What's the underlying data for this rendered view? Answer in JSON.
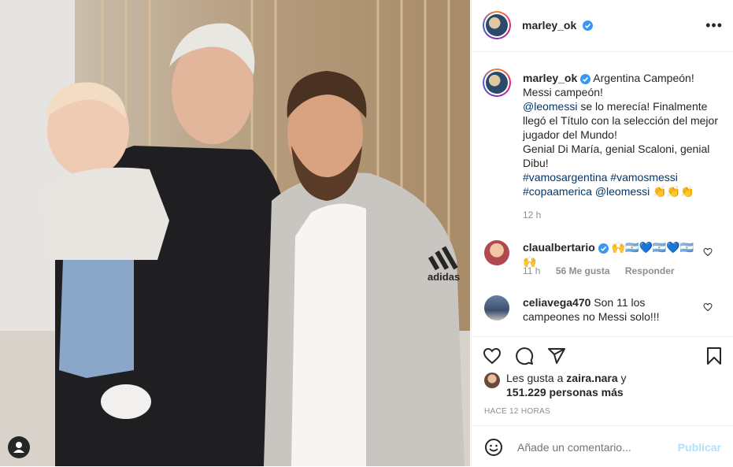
{
  "post": {
    "image_alt": "Photo of two men and a baby",
    "author": "marley_ok"
  },
  "header": {
    "username": "marley_ok",
    "more_icon": "more-horizontal-icon"
  },
  "caption": {
    "username": "marley_ok",
    "line1": "Argentina Campeón!",
    "line2": "Messi campeón!",
    "mention1": "@leomessi",
    "line3_rest": " se lo merecía! Finalmente llegó el Título con la selección del mejor jugador del Mundo!",
    "line4": "Genial Di María, genial Scaloni, genial Dibu!",
    "hashtag1": "#vamosargentina",
    "hashtag2": "#vamosmessi",
    "hashtag3": "#copaamerica",
    "mention2": "@leomessi",
    "emoji": "👏👏👏",
    "time": "12 h"
  },
  "comments": [
    {
      "username": "claualbertario",
      "text": "🙌🇦🇷💙🇦🇷💙🇦🇷🙌",
      "time": "11 h",
      "likes": "56 Me gusta",
      "reply": "Responder",
      "verified": true
    },
    {
      "username": "celiavega470",
      "text": "Son 11 los campeones no Messi solo!!!",
      "verified": false
    }
  ],
  "likes": {
    "prefix": "Les gusta a ",
    "user": "zaira.nara",
    "joiner": " y",
    "count": "151.229 personas más"
  },
  "time_ago": "HACE 12 HORAS",
  "comment_input": {
    "placeholder": "Añade un comentario...",
    "publish": "Publicar"
  },
  "colors": {
    "link": "#00376b",
    "verified": "#3897f0",
    "muted": "#8e8e8e",
    "publish_disabled": "#b2dffc"
  }
}
